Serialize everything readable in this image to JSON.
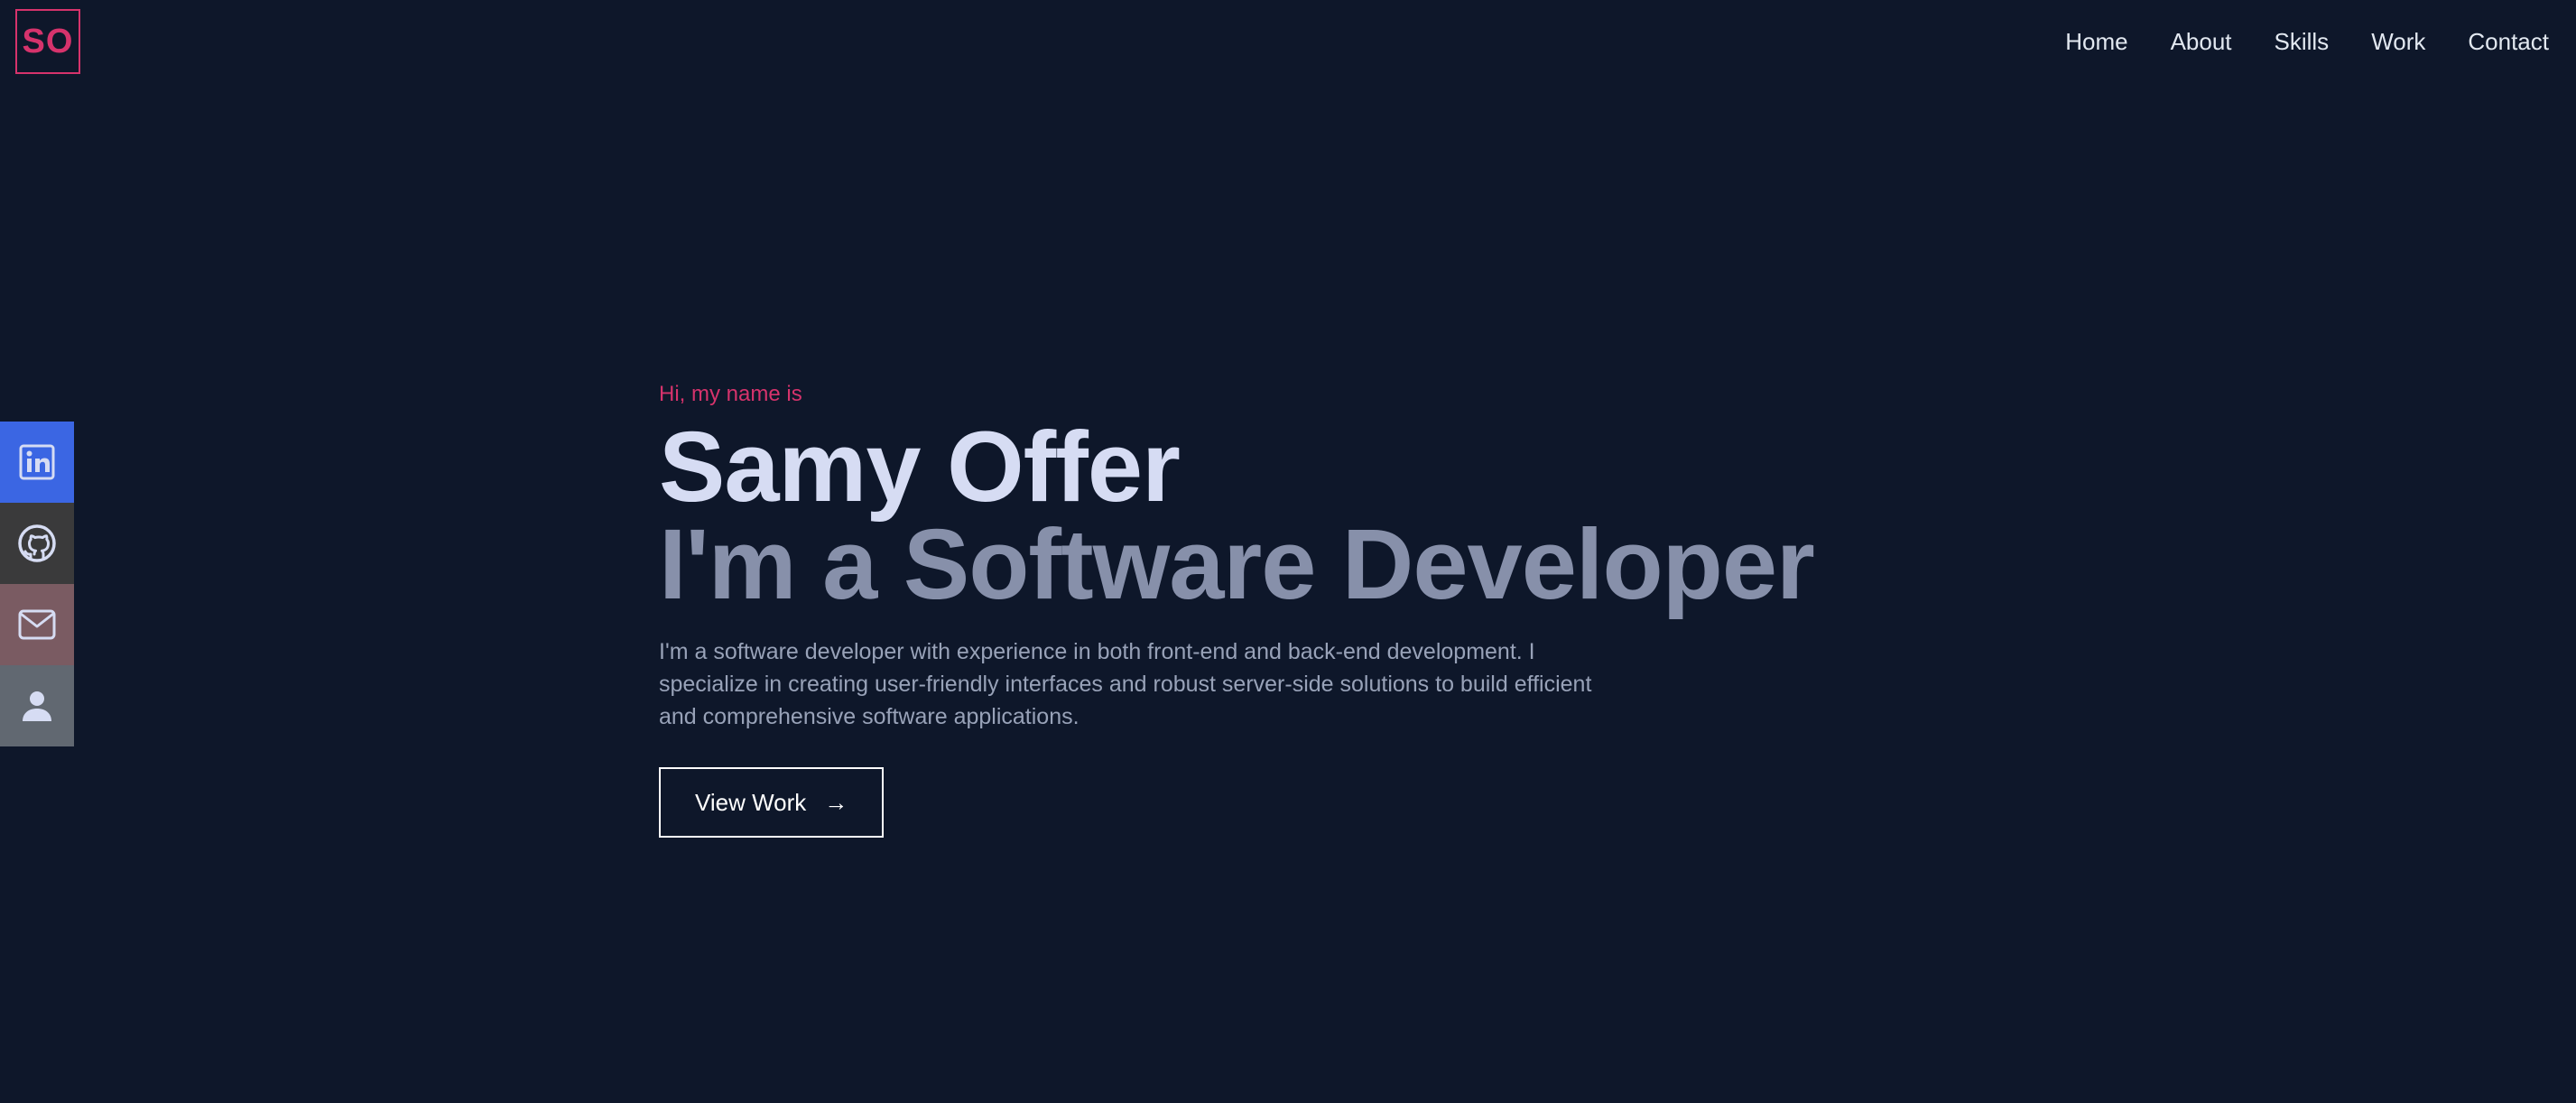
{
  "logo": {
    "text": "SO"
  },
  "nav": {
    "items": [
      {
        "label": "Home"
      },
      {
        "label": "About"
      },
      {
        "label": "Skills"
      },
      {
        "label": "Work"
      },
      {
        "label": "Contact"
      }
    ]
  },
  "social": {
    "items": [
      {
        "icon": "linkedin-icon",
        "color": "#3b66e3"
      },
      {
        "icon": "github-icon",
        "color": "#3a3a3b"
      },
      {
        "icon": "mail-icon",
        "color": "#7a5b62"
      },
      {
        "icon": "user-icon",
        "color": "#616871"
      }
    ]
  },
  "hero": {
    "intro": "Hi, my name is",
    "name": "Samy Offer",
    "role": "I'm a Software Developer",
    "description": "I'm a software developer with experience in both front-end and back-end development. I specialize in creating user-friendly interfaces and robust server-side solutions to build efficient and comprehensive software applications.",
    "cta_label": "View Work",
    "cta_arrow": "→"
  },
  "colors": {
    "background": "#0e172a",
    "accent": "#d6336c",
    "heading": "#d6dcf3",
    "subheading": "#8790aa",
    "text": "#98a2b8"
  }
}
